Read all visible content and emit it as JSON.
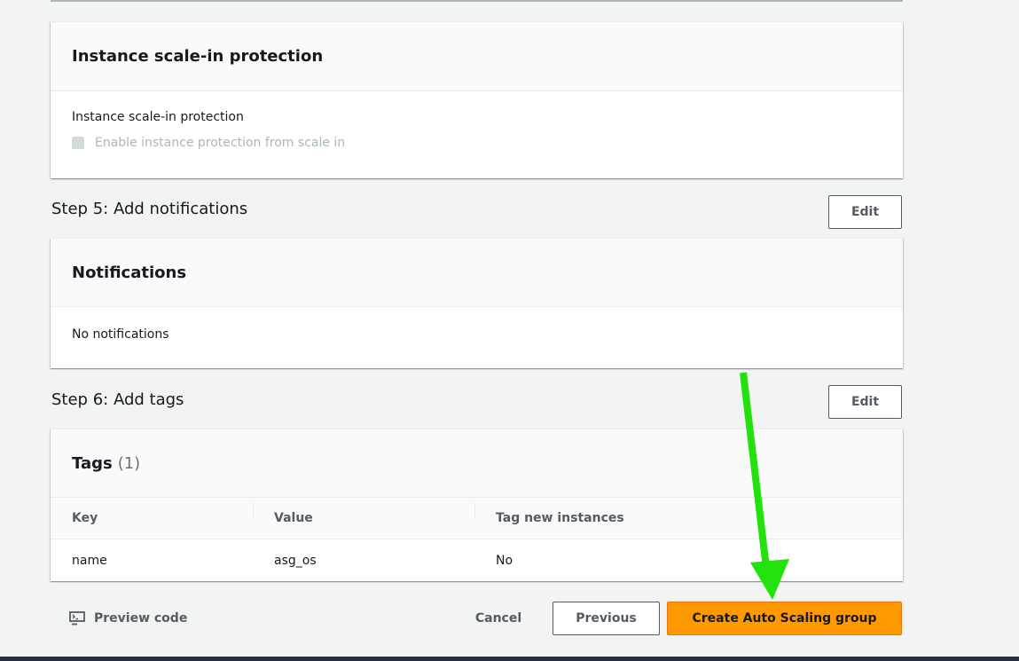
{
  "scale_in": {
    "header": "Instance scale-in protection",
    "label": "Instance scale-in protection",
    "checkbox_label": "Enable instance protection from scale in"
  },
  "step5": {
    "title": "Step 5: Add notifications",
    "edit_label": "Edit",
    "panel_header": "Notifications",
    "body": "No notifications"
  },
  "step6": {
    "title": "Step 6: Add tags",
    "edit_label": "Edit",
    "panel_header": "Tags",
    "count": "(1)",
    "columns": [
      "Key",
      "Value",
      "Tag new instances"
    ],
    "rows": [
      [
        "name",
        "asg_os",
        "No"
      ]
    ]
  },
  "footer": {
    "preview_code": "Preview code",
    "cancel": "Cancel",
    "previous": "Previous",
    "create": "Create Auto Scaling group"
  },
  "colors": {
    "primary_button": "#ff9900",
    "annotation_arrow": "#22e10d"
  }
}
